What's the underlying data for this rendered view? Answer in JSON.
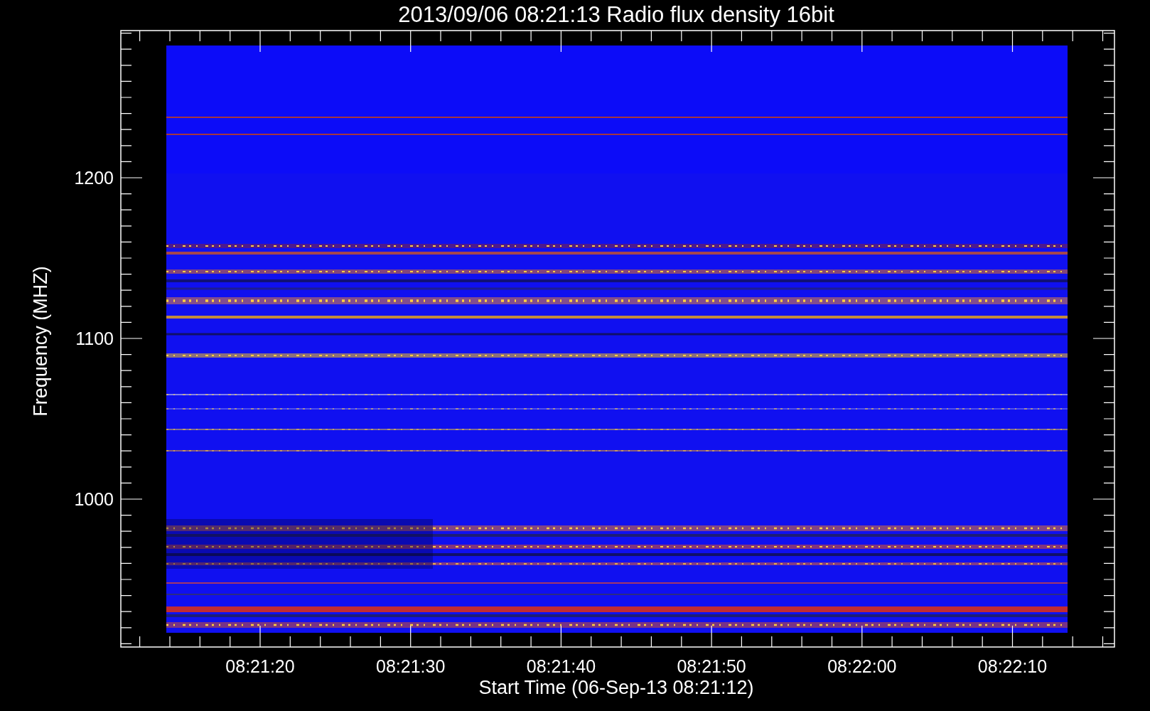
{
  "plot": {
    "title": "2013/09/06 08:21:13 Radio flux density 16bit",
    "xlabel": "Start Time (06-Sep-13 08:21:12)",
    "ylabel": "Frequency (MHZ)",
    "x_tick_labels": [
      "08:21:20",
      "08:21:30",
      "08:21:40",
      "08:21:50",
      "08:22:00",
      "08:22:10"
    ],
    "y_tick_labels": [
      "1200",
      "1100",
      "1000"
    ]
  }
}
